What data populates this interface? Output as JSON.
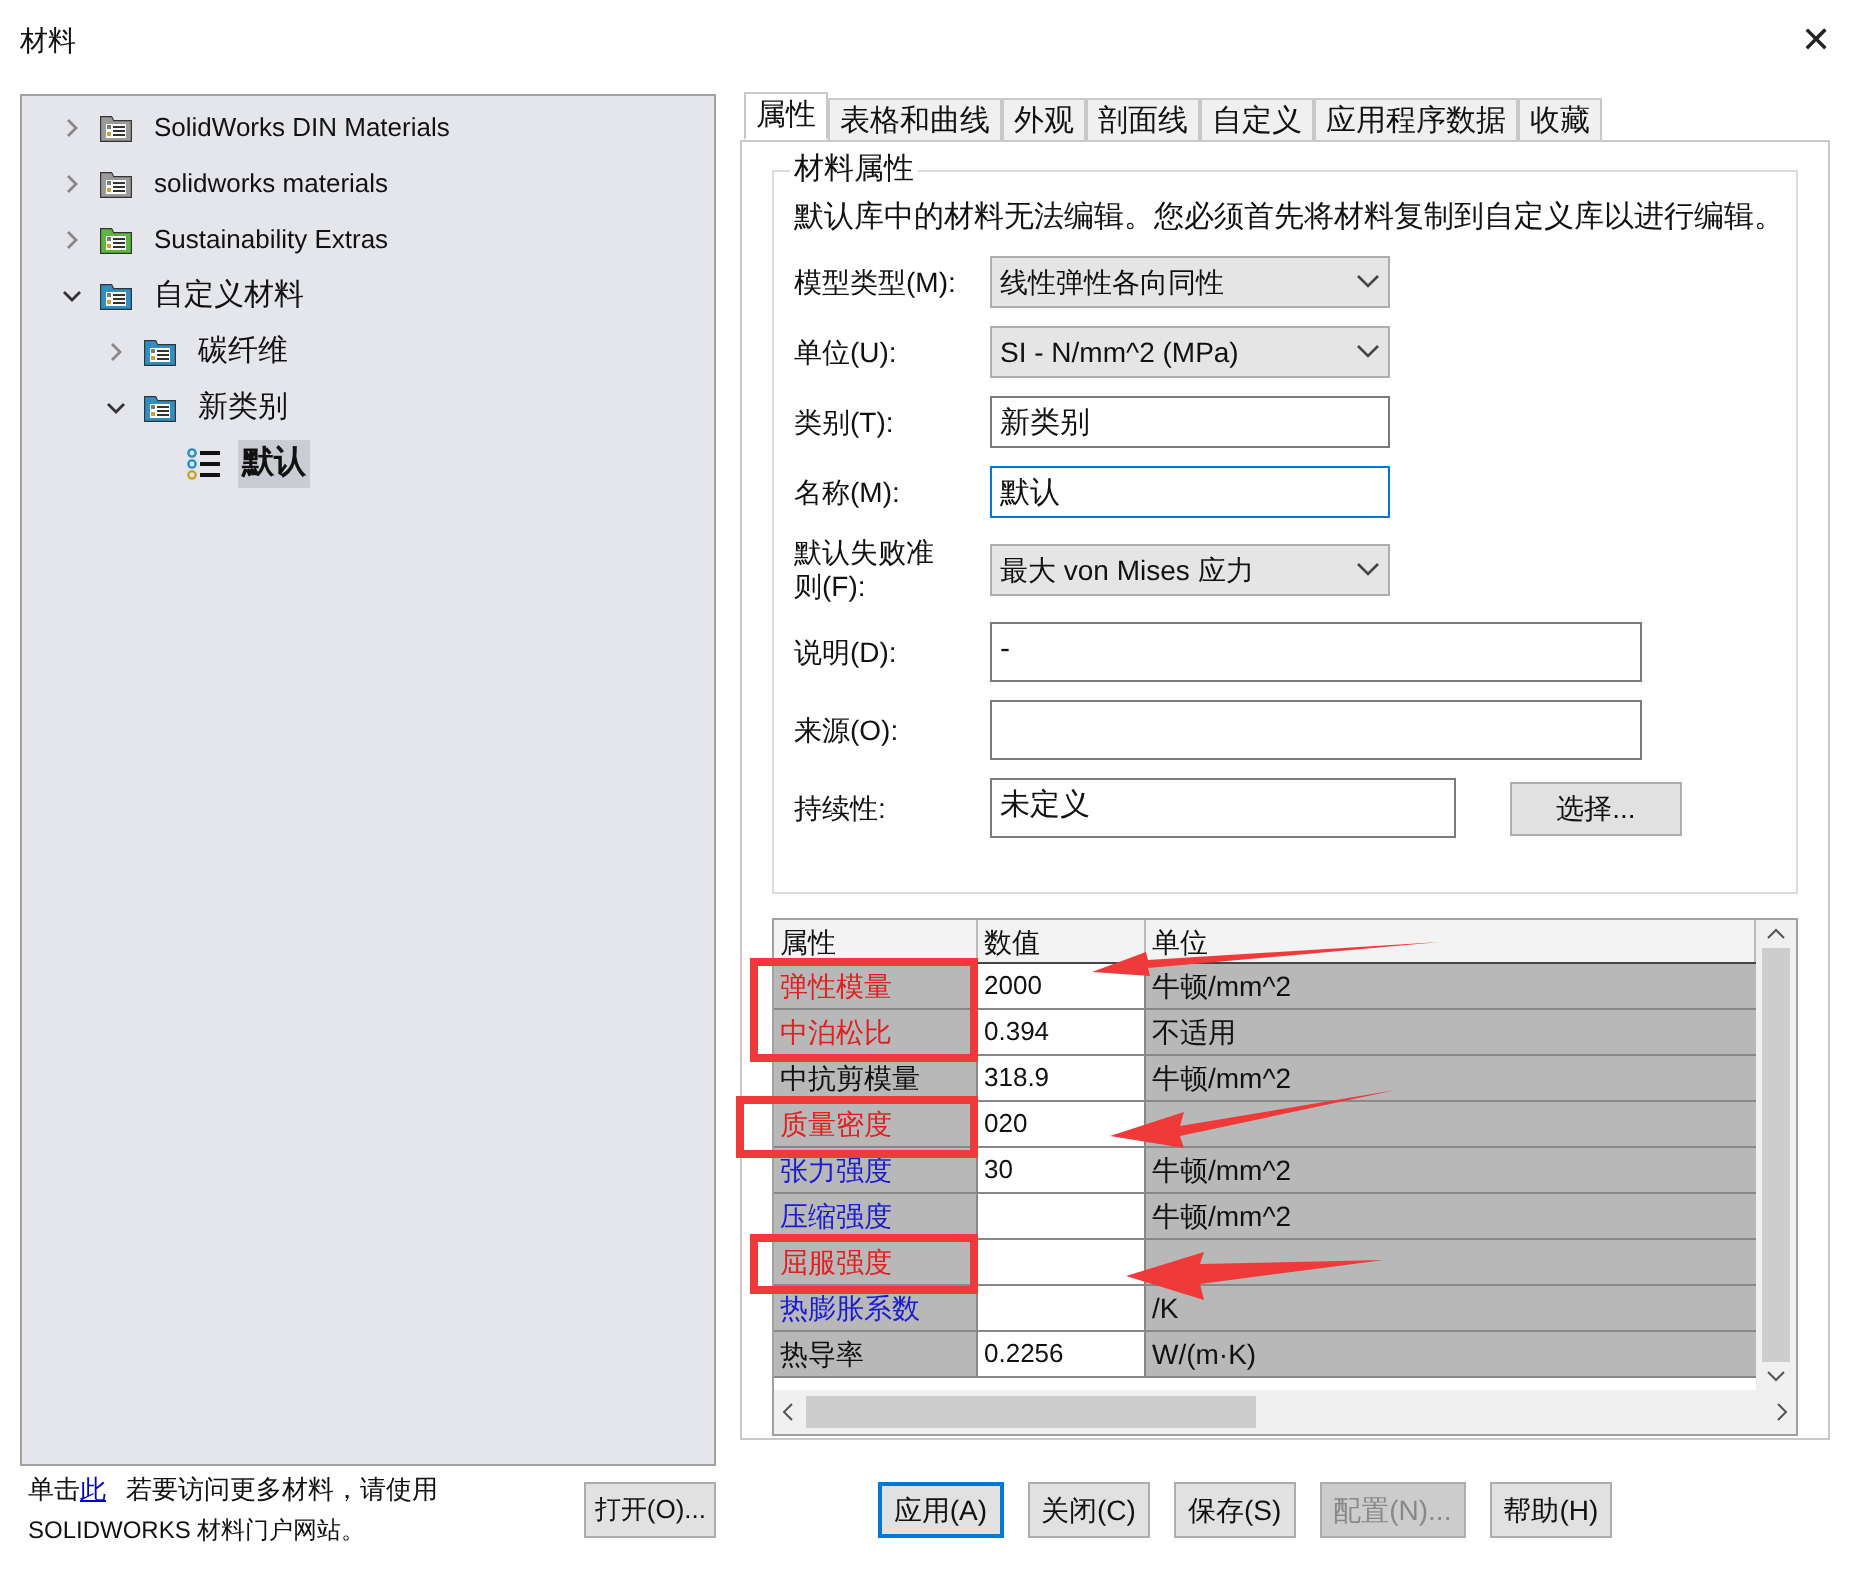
{
  "window": {
    "title": "材料",
    "close": "✕"
  },
  "tree": [
    {
      "label": "SolidWorks DIN Materials",
      "color": "#9a9a9a",
      "expanded": false,
      "selected": false
    },
    {
      "label": "solidworks materials",
      "color": "#9a9a9a",
      "expanded": false,
      "selected": false
    },
    {
      "label": "Sustainability Extras",
      "color": "#5cb83a",
      "expanded": false,
      "selected": false
    },
    {
      "label": "自定义材料",
      "color": "#2e8fc4",
      "expanded": true,
      "selected": false,
      "children": [
        {
          "label": "碳纤维",
          "color": "#2e8fc4",
          "expanded": false,
          "selected": false
        },
        {
          "label": "新类别",
          "color": "#2e8fc4",
          "expanded": true,
          "selected": false,
          "children": [
            {
              "label": "默认",
              "kind": "material",
              "selected": true
            }
          ]
        }
      ]
    }
  ],
  "footer_note": {
    "before": "单击",
    "link": "此",
    "after": "若要访问更多材料，请使用",
    "line2": "SOLIDWORKS 材料门户网站。"
  },
  "open_button": "打开(O)...",
  "tabs": [
    {
      "label": "属性",
      "selected": true
    },
    {
      "label": "表格和曲线",
      "selected": false
    },
    {
      "label": "外观",
      "selected": false
    },
    {
      "label": "剖面线",
      "selected": false
    },
    {
      "label": "自定义",
      "selected": false
    },
    {
      "label": "应用程序数据",
      "selected": false
    },
    {
      "label": "收藏",
      "selected": false
    }
  ],
  "group": {
    "title": "材料属性",
    "note": "默认库中的材料无法编辑。您必须首先将材料复制到自定义库以进行编辑。"
  },
  "fields": [
    {
      "label": "模型类型(M):",
      "kind": "select",
      "value": "线性弹性各向同性"
    },
    {
      "label": "单位(U):",
      "kind": "select",
      "value": "SI - N/mm^2 (MPa)"
    },
    {
      "label": "类别(T):",
      "kind": "text",
      "value": "新类别",
      "focused": false
    },
    {
      "label": "名称(M):",
      "kind": "text",
      "value": "默认",
      "focused": true
    },
    {
      "label": "默认失败准则(F):",
      "kind": "select",
      "value": "最大 von Mises 应力"
    },
    {
      "label": "说明(D):",
      "kind": "text",
      "value": "-",
      "focused": false
    },
    {
      "label": "来源(O):",
      "kind": "text",
      "focused": false
    },
    {
      "label": "持续性:",
      "kind": "text",
      "value": "未定义",
      "focused": false,
      "button": "选择..."
    }
  ],
  "table": {
    "columns": [
      "属性",
      "数值",
      "单位"
    ],
    "rows": [
      {
        "property": "弹性模量",
        "color": "#e02020",
        "value": "2000",
        "unit": "牛顿/mm^2"
      },
      {
        "property": "中泊松比",
        "color": "#e02020",
        "value": "0.394",
        "unit": "不适用"
      },
      {
        "property": "中抗剪模量",
        "color": "#111111",
        "value": "318.9",
        "unit": "牛顿/mm^2"
      },
      {
        "property": "质量密度",
        "color": "#e02020",
        "value": "020"
      },
      {
        "property": "张力强度",
        "color": "#1a1ad0",
        "value": "30",
        "unit": "牛顿/mm^2"
      },
      {
        "property": "压缩强度",
        "color": "#1a1ad0",
        "unit": "牛顿/mm^2"
      },
      {
        "property": "屈服强度",
        "color": "#e02020"
      },
      {
        "property": "热膨胀系数",
        "color": "#1a1ad0",
        "unit": "/K"
      },
      {
        "property": "热导率",
        "color": "#111111",
        "value": "0.2256",
        "unit": "W/(m·K)"
      }
    ]
  },
  "buttons": [
    {
      "label": "应用(A)",
      "default": true,
      "disabled": false
    },
    {
      "label": "关闭(C)",
      "default": false,
      "disabled": false
    },
    {
      "label": "保存(S)",
      "default": false,
      "disabled": false
    },
    {
      "label": "配置(N)...",
      "default": false,
      "disabled": true
    },
    {
      "label": "帮助(H)",
      "default": false,
      "disabled": false
    }
  ]
}
